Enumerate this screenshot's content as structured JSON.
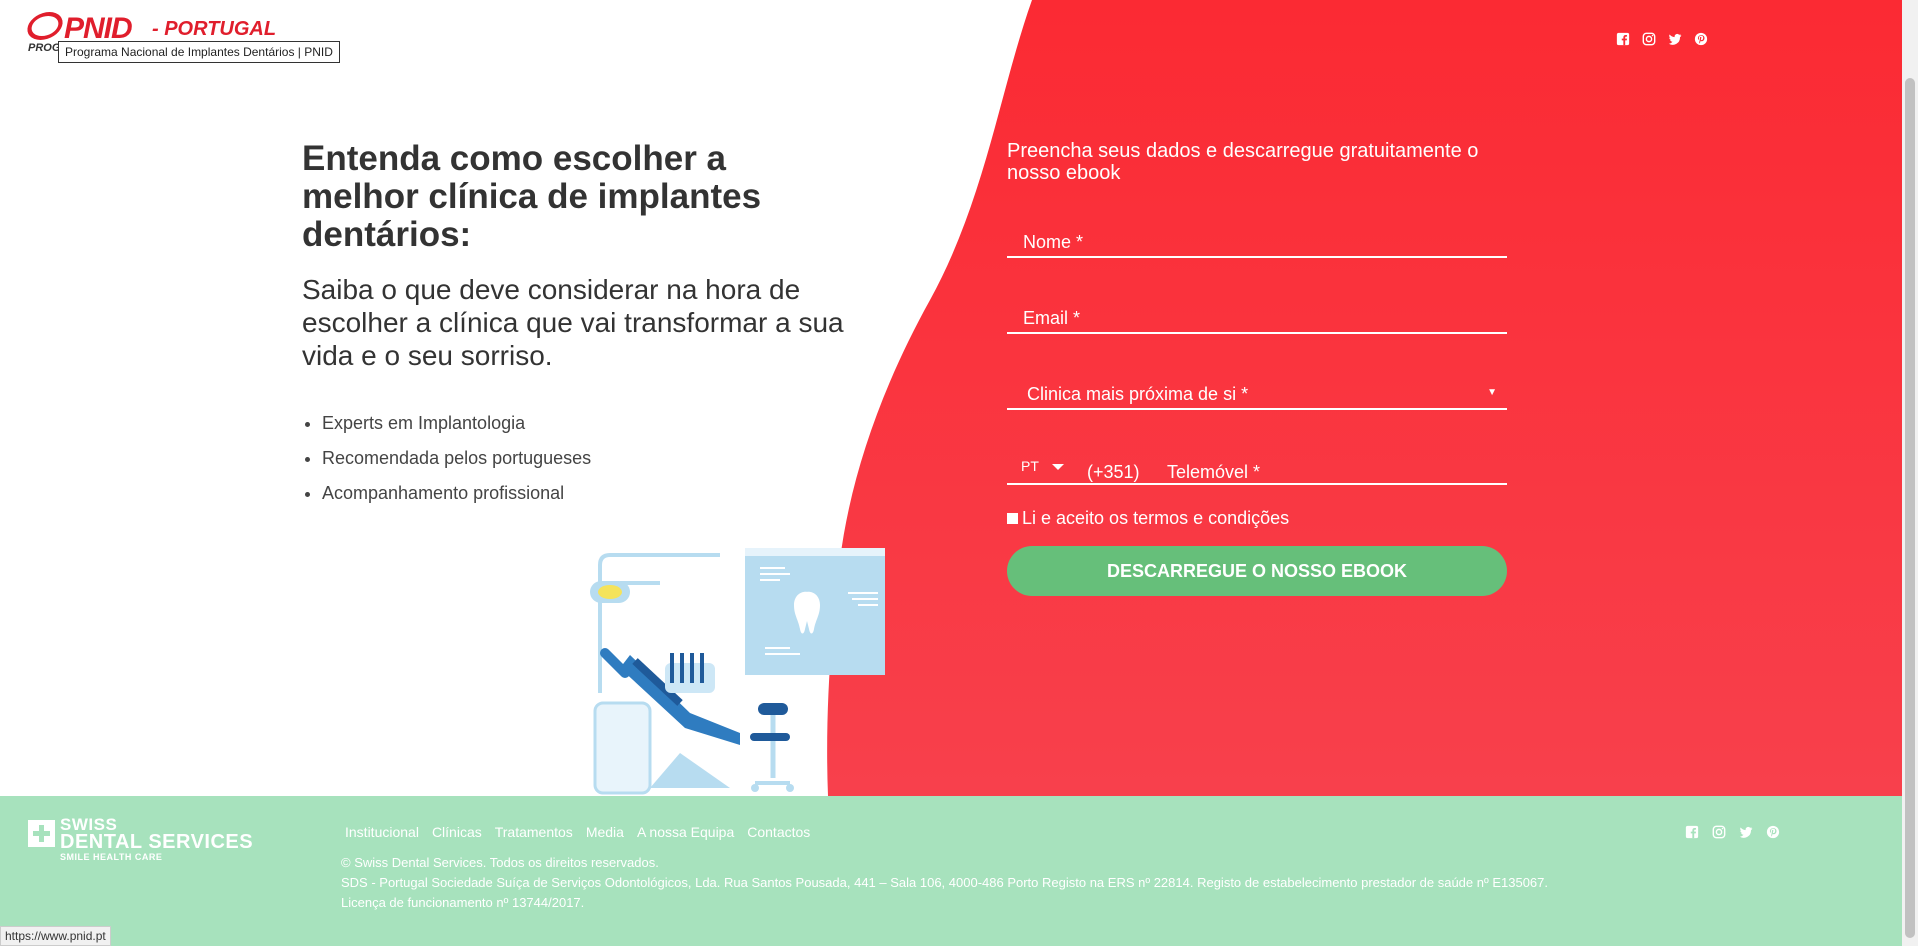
{
  "header": {
    "logo_text": "PNID",
    "logo_country": "- PORTUGAL",
    "logo_sub": "PROG",
    "tooltip": "Programa Nacional de Implantes Dentários | PNID"
  },
  "hero": {
    "headline": "Entenda como escolher a melhor clínica de implantes dentários:",
    "subline": "Saiba o que deve considerar na hora de escolher a clínica que vai transformar a sua vida e o seu sorriso.",
    "bullets": [
      "Experts em Implantologia",
      "Recomendada pelos portugueses",
      "Acompanhamento profissional"
    ]
  },
  "form": {
    "intro": "Preencha seus dados e descarregue gratuitamente o nosso ebook",
    "name_placeholder": "Nome *",
    "email_placeholder": "Email *",
    "clinic_placeholder": "Clinica mais próxima de si *",
    "country_code": "PT",
    "phone_prefix": "(+351)",
    "phone_placeholder": "Telemóvel *",
    "terms_label": "Li e aceito os termos e condições",
    "submit_label": "DESCARREGUE O NOSSO EBOOK"
  },
  "footer": {
    "brand_line1": "SWISS",
    "brand_line2": "DENTAL SERVICES",
    "brand_line3": "SMILE HEALTH CARE",
    "nav": [
      "Institucional",
      "Clínicas",
      "Tratamentos",
      "Media",
      "A nossa Equipa",
      "Contactos"
    ],
    "copyright": "© Swiss Dental Services. Todos os direitos reservados.",
    "legal": "SDS - Portugal Sociedade Suíça de Serviços Odontológicos, Lda. Rua Santos Pousada, 441 – Sala 106, 4000-486 Porto Registo na ERS nº 22814. Registo de estabelecimento prestador de saúde nº E135067. Licença de funcionamento nº 13744/2017."
  },
  "status_bar": {
    "url": "https://www.pnid.pt"
  },
  "social": [
    "facebook-icon",
    "instagram-icon",
    "twitter-icon",
    "pinterest-icon"
  ],
  "colors": {
    "brand_red": "#fa2a34",
    "footer_green": "#a7e2bd",
    "button_green": "#66bf7a"
  }
}
